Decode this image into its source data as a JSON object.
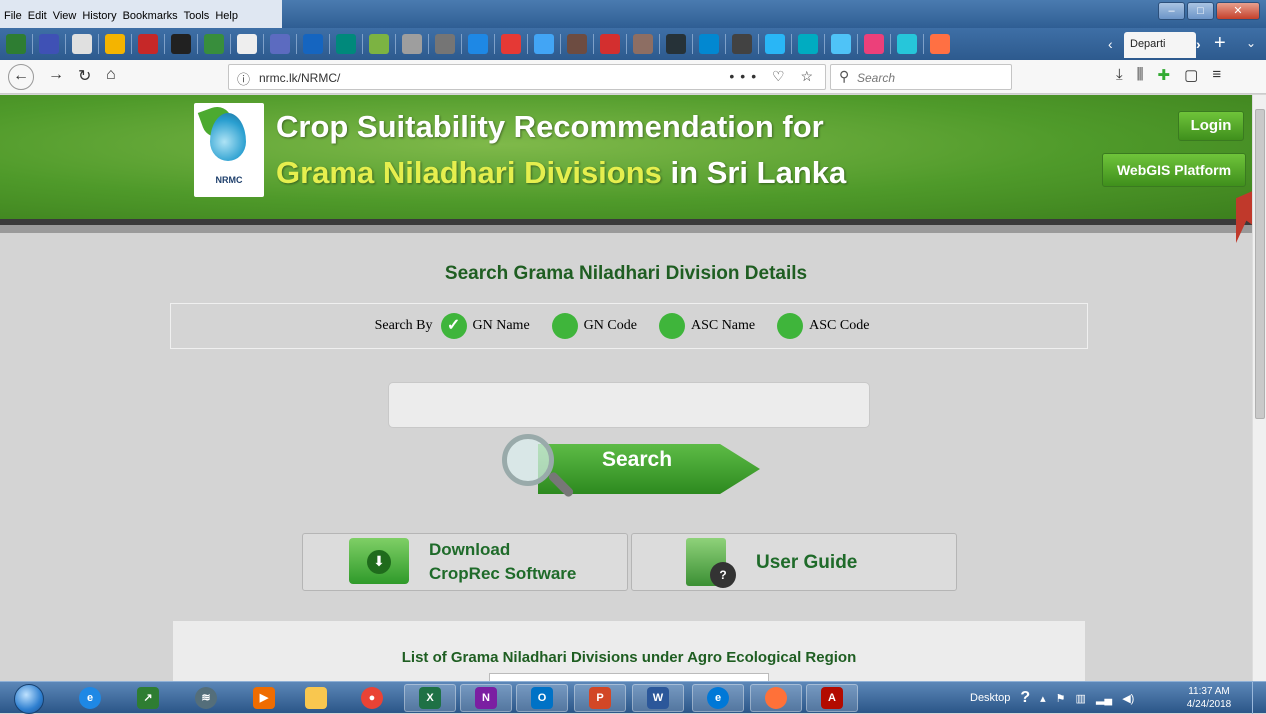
{
  "menu": {
    "file": "File",
    "edit": "Edit",
    "view": "View",
    "history": "History",
    "bookmarks": "Bookmarks",
    "tools": "Tools",
    "help": "Help"
  },
  "tab": {
    "label": "Departi"
  },
  "url": {
    "text": "nrmc.lk/NRMC/",
    "dots": "•••"
  },
  "search_box": {
    "placeholder": "Search"
  },
  "header": {
    "logo_text": "NRMC",
    "title_line1": "Crop Suitability Recommendation for",
    "title_line2_highlight": "Grama Niladhari Divisions",
    "title_line2_rest": " in Sri Lanka",
    "login_label": "Login",
    "webgis_label": "WebGIS Platform"
  },
  "search_section": {
    "title": "Search Grama Niladhari Division Details",
    "search_by_label": "Search By",
    "options": [
      {
        "label": "GN Name",
        "selected": true
      },
      {
        "label": "GN Code",
        "selected": false
      },
      {
        "label": "ASC Name",
        "selected": false
      },
      {
        "label": "ASC Code",
        "selected": false
      }
    ],
    "search_button": "Search"
  },
  "downloads": {
    "download_line1": "Download",
    "download_line2": "CropRec Software",
    "user_guide": "User Guide"
  },
  "list_panel": {
    "title": "List of Grama Niladhari Divisions under Agro Ecological Region"
  },
  "taskbar": {
    "desktop_label": "Desktop",
    "time": "11:37 AM",
    "date": "4/24/2018"
  },
  "colors": {
    "brand_green": "#4f9a2a",
    "title_yellow": "#e6ef4e",
    "heading_green": "#1f5e22"
  }
}
